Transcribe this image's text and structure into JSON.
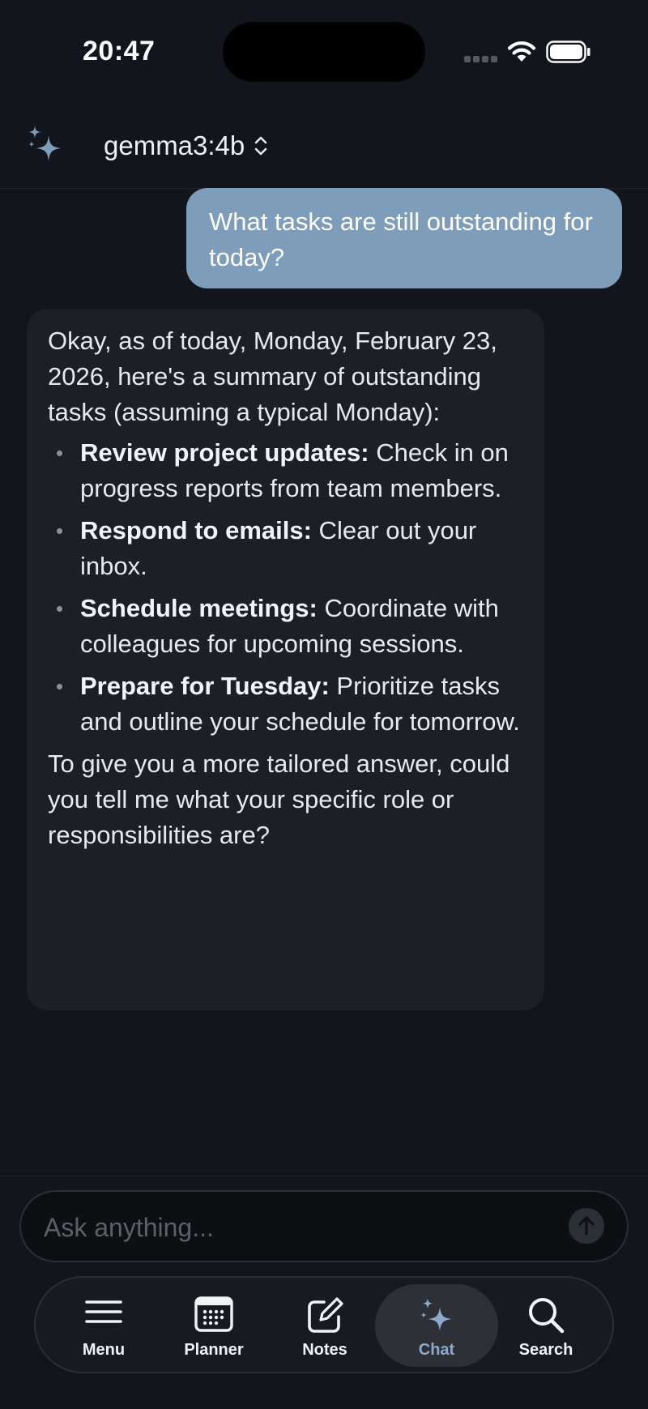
{
  "status_bar": {
    "time": "20:47"
  },
  "header": {
    "model_name": "gemma3:4b",
    "sparkle_icon": "sparkles-icon",
    "chevron_icon": "chevron-up-down-icon"
  },
  "messages": {
    "user": {
      "text": "What tasks are still outstanding for today?"
    },
    "assistant": {
      "intro": "Okay, as of today, Monday, February 23, 2026, here's a summary of outstanding tasks (assuming a typical Monday):",
      "items": [
        {
          "title": "Review project updates:",
          "text": " Check in on progress reports from team members."
        },
        {
          "title": "Respond to emails:",
          "text": " Clear out your inbox."
        },
        {
          "title": "Schedule meetings:",
          "text": " Coordinate with colleagues for upcoming sessions."
        },
        {
          "title": "Prepare for Tuesday:",
          "text": " Prioritize tasks and outline your schedule for tomorrow."
        }
      ],
      "bullet": "•",
      "outro": "To give you a more tailored answer, could you tell me what your specific role or responsibilities are?"
    }
  },
  "input": {
    "placeholder": "Ask anything...",
    "value": "",
    "send_icon": "arrow-up-icon"
  },
  "tabbar": {
    "tabs": [
      {
        "label": "Menu",
        "icon": "hamburger-menu-icon",
        "active": false
      },
      {
        "label": "Planner",
        "icon": "calendar-icon",
        "active": false
      },
      {
        "label": "Notes",
        "icon": "compose-icon",
        "active": false
      },
      {
        "label": "Chat",
        "icon": "sparkles-icon",
        "active": true
      },
      {
        "label": "Search",
        "icon": "magnifier-icon",
        "active": false
      }
    ]
  },
  "colors": {
    "background": "#12151b",
    "user_bubble": "#7e9dbb",
    "assistant_bubble": "#1c1f26",
    "accent": "#8eaacb"
  }
}
